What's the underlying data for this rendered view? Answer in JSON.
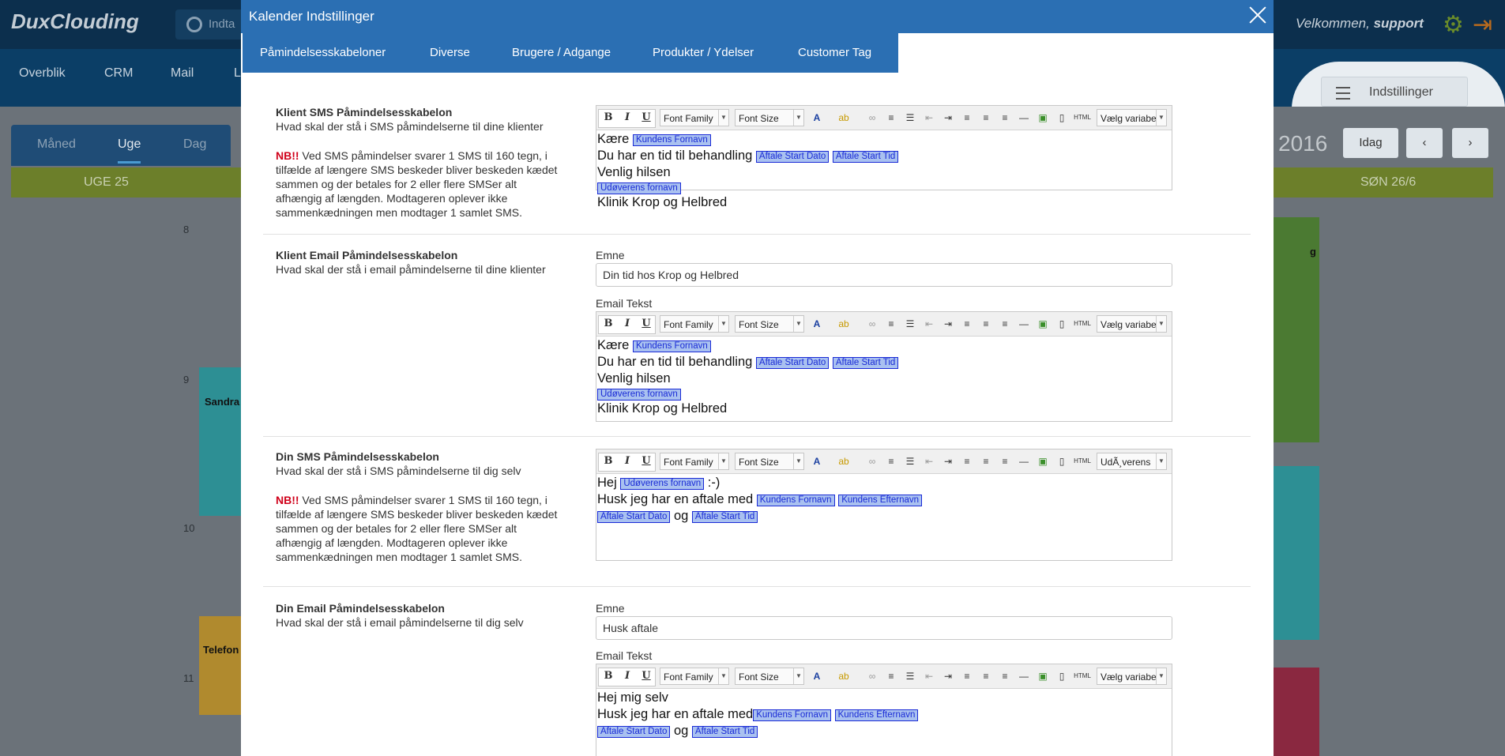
{
  "background": {
    "logo": "DuxClouding",
    "search_placeholder": "Indta",
    "welcome_prefix": "Velkommen,",
    "welcome_user": "support",
    "nav": [
      "Overblik",
      "CRM",
      "Mail",
      "L"
    ],
    "settings_button": "Indstillinger",
    "view_tabs": [
      "Måned",
      "Uge",
      "Dag"
    ],
    "week_label": "UGE 25",
    "year_partial": "2016",
    "today_button": "Idag",
    "sunday_label": "SØN 26/6",
    "hours": [
      "8",
      "9",
      "10",
      "11"
    ],
    "events": [
      {
        "label": "Sandra"
      },
      {
        "label": "Telefon"
      },
      {
        "label": "g"
      }
    ]
  },
  "modal": {
    "title": "Kalender Indstillinger",
    "tabs": [
      "Påmindelsesskabeloner",
      "Diverse",
      "Brugere / Adgange",
      "Produkter / Ydelser",
      "Customer Tag"
    ]
  },
  "toolbar": {
    "font_family": "Font Family",
    "font_size": "Font Size",
    "variable_select_default": "Vælg variabe",
    "variable_select_alt": "UdÃ¸verens",
    "bold": "B",
    "italic": "I",
    "underline": "U",
    "html": "HTML"
  },
  "sections": {
    "client_sms": {
      "title": "Klient SMS Påmindelsesskabelon",
      "desc": "Hvad skal der stå i SMS påmindelserne til dine klienter",
      "nb": "NB!!",
      "note": " Ved SMS påmindelser svarer 1 SMS til 160 tegn, i tilfælde af længere SMS beskeder bliver beskeden kædet sammen og der betales for 2 eller flere SMSer alt afhængig af længden. Modtageren oplever ikke sammenkædningen men modtager 1 samlet SMS.",
      "line1_text": "Kære",
      "line1_tag": "Kundens Fornavn",
      "line2_text": "Du har en tid til behandling",
      "line2_tag1": "Aftale Start Dato",
      "line2_tag2": "Aftale Start Tid",
      "line3_text": "Venlig hilsen",
      "line4_tag": "Udøverens fornavn",
      "line5_text": "Klinik Krop og Helbred"
    },
    "client_email": {
      "title": "Klient Email Påmindelsesskabelon",
      "desc": "Hvad skal der stå i email påmindelserne til dine klienter",
      "subject_label": "Emne",
      "subject_value": "Din tid hos Krop og Helbred",
      "body_label": "Email Tekst",
      "line1_text": "Kære",
      "line1_tag": "Kundens Fornavn",
      "line2_text": "Du har en tid til behandling",
      "line2_tag1": "Aftale Start Dato",
      "line2_tag2": "Aftale Start Tid",
      "line3_text": "Venlig hilsen",
      "line4_tag": "Udøverens fornavn",
      "line5_text": "Klinik Krop og Helbred"
    },
    "own_sms": {
      "title": "Din SMS Påmindelsesskabelon",
      "desc": "Hvad skal der stå i SMS påmindelserne til dig selv",
      "nb": "NB!!",
      "note": " Ved SMS påmindelser svarer 1 SMS til 160 tegn, i tilfælde af længere SMS beskeder bliver beskeden kædet sammen og der betales for 2 eller flere SMSer alt afhængig af længden. Modtageren oplever ikke sammenkædningen men modtager 1 samlet SMS.",
      "line1_text": "Hej",
      "line1_tag": "Udøverens fornavn",
      "line1_suffix": " :-)",
      "line2_text": "Husk jeg har en aftale med",
      "line2_tag1": "Kundens Fornavn",
      "line2_tag2": "Kundens Efternavn",
      "line3_tag1": "Aftale Start Dato",
      "line3_mid": " og ",
      "line3_tag2": "Aftale Start Tid"
    },
    "own_email": {
      "title": "Din Email Påmindelsesskabelon",
      "desc": "Hvad skal der stå i email påmindelserne til dig selv",
      "subject_label": "Emne",
      "subject_value": "Husk aftale",
      "body_label": "Email Tekst",
      "line1_text": "Hej mig selv",
      "line2_text": "Husk jeg har en aftale med",
      "line2_tag1": "Kundens Fornavn",
      "line2_tag2": "Kundens Efternavn",
      "line3_tag1": "Aftale Start Dato",
      "line3_mid": " og ",
      "line3_tag2": "Aftale Start Tid"
    }
  }
}
